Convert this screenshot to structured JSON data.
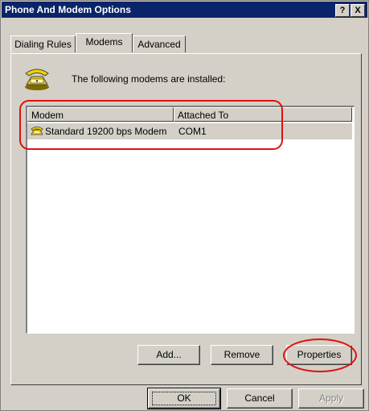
{
  "window": {
    "title": "Phone And Modem Options",
    "help_button": "?",
    "close_button": "X"
  },
  "tabs": [
    {
      "label": "Dialing Rules",
      "active": false
    },
    {
      "label": "Modems",
      "active": true
    },
    {
      "label": "Advanced",
      "active": false
    }
  ],
  "modems_tab": {
    "installed_text": "The following modems are installed:",
    "columns": [
      "Modem",
      "Attached To"
    ],
    "rows": [
      {
        "modem": "Standard 19200 bps Modem",
        "attached_to": "COM1",
        "selected": true
      }
    ],
    "buttons": {
      "add": "Add...",
      "remove": "Remove",
      "properties": "Properties"
    }
  },
  "footer_buttons": {
    "ok": "OK",
    "cancel": "Cancel",
    "apply": "Apply"
  },
  "colors": {
    "titlebar": "#0a246a",
    "annotation": "#e01010",
    "dialog_bg": "#d4d0c8"
  }
}
